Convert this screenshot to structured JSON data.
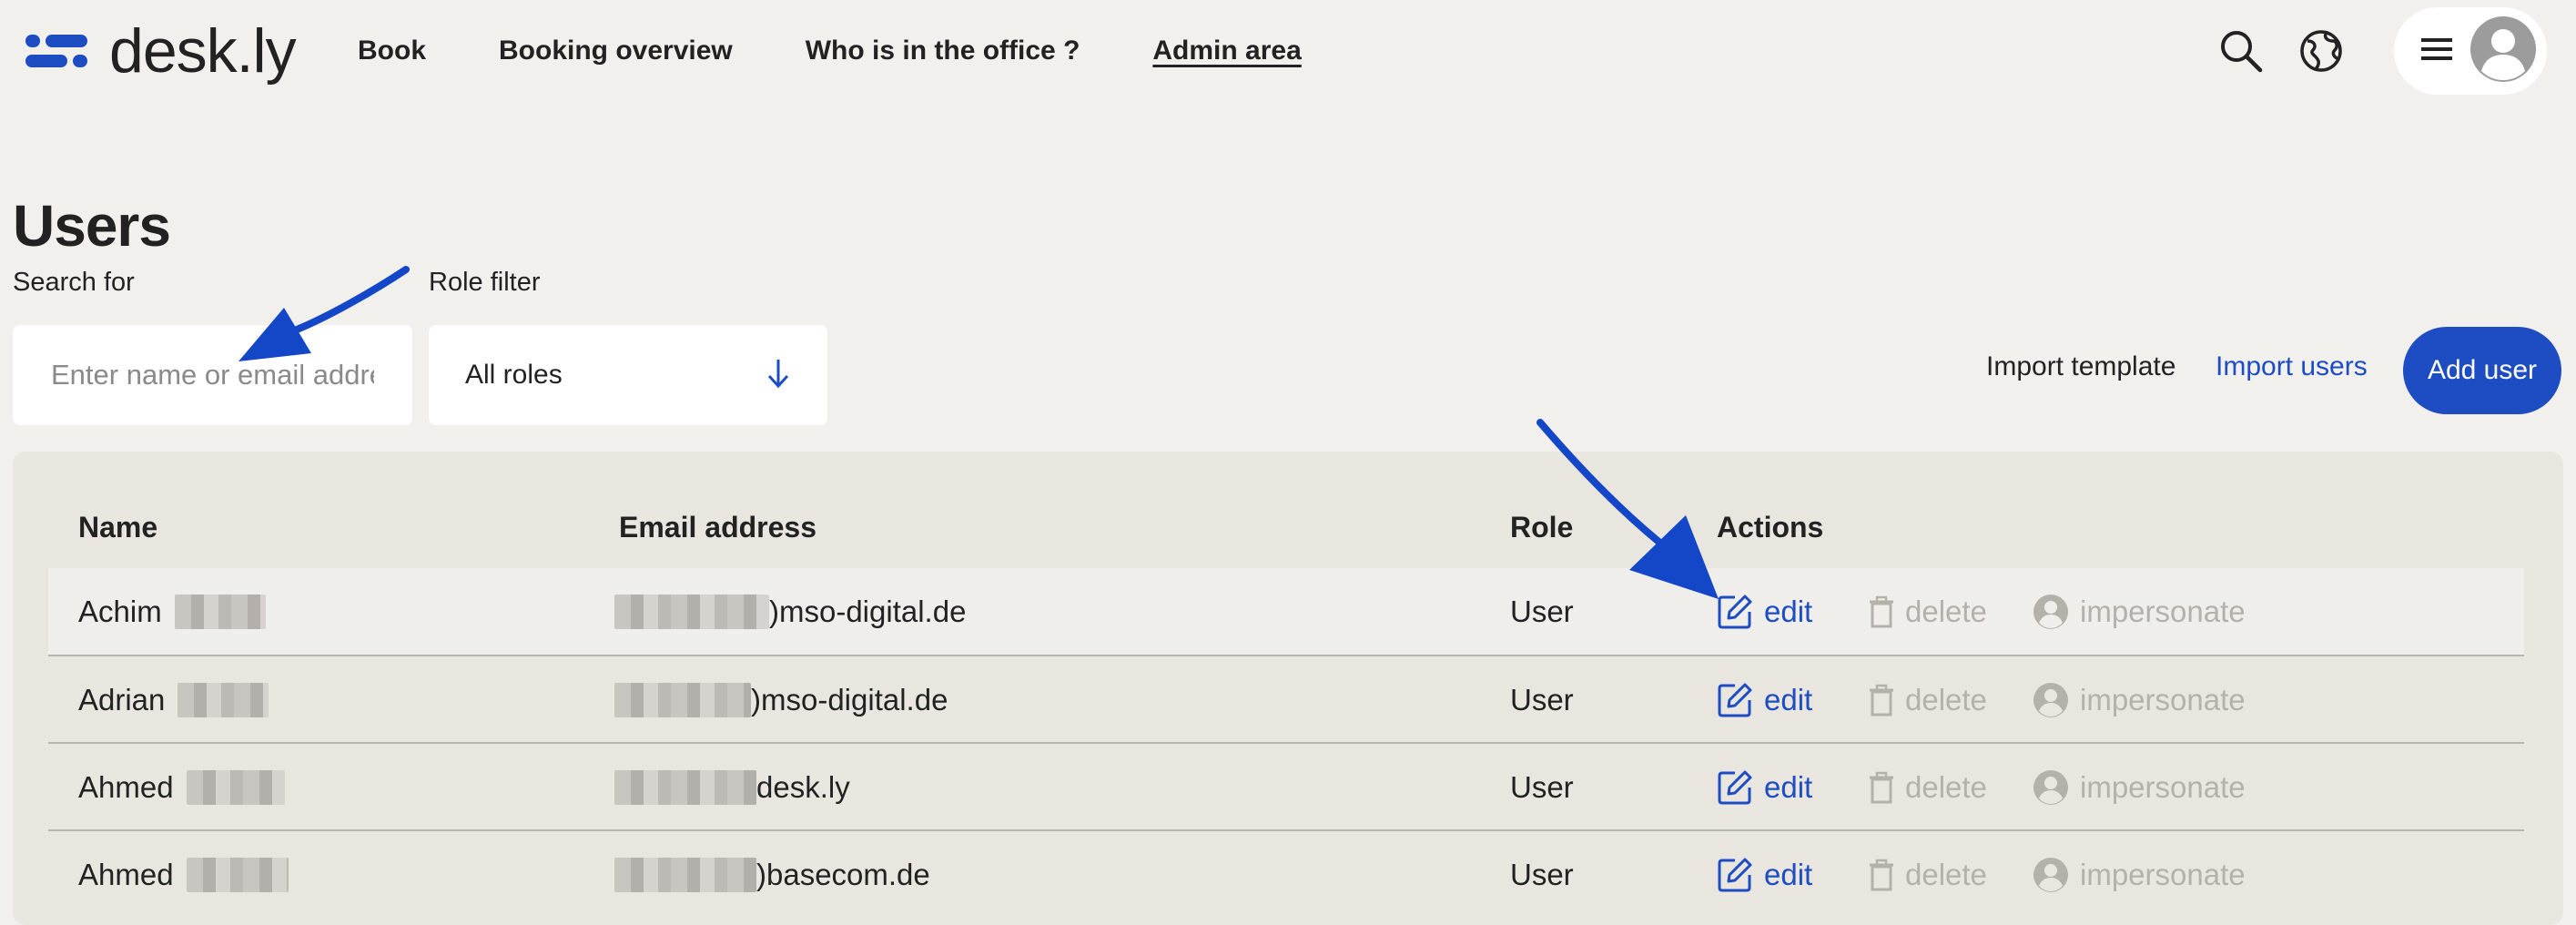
{
  "app": {
    "logo_text": "desk.ly",
    "brand_color": "#1d4cc3"
  },
  "nav": {
    "items": [
      {
        "label": "Book"
      },
      {
        "label": "Booking overview"
      },
      {
        "label": "Who is in the office ?"
      },
      {
        "label": "Admin area",
        "active": true
      }
    ],
    "icons": [
      "search-icon",
      "globe-icon",
      "menu-icon",
      "avatar-icon"
    ]
  },
  "page": {
    "title": "Users"
  },
  "filters": {
    "search_label": "Search for",
    "search_placeholder": "Enter name or email address",
    "search_value": "",
    "role_label": "Role filter",
    "role_value": "All roles"
  },
  "toolbar": {
    "import_template": "Import template",
    "import_users": "Import users",
    "add_user": "Add user"
  },
  "table": {
    "columns": {
      "name": "Name",
      "email": "Email address",
      "role": "Role",
      "actions": "Actions"
    },
    "action_labels": {
      "edit": "edit",
      "delete": "delete",
      "impersonate": "impersonate"
    },
    "rows": [
      {
        "first_name": "Achim",
        "email_domain": "mso-digital.de",
        "email_shown": ")mso-digital.de",
        "role": "User"
      },
      {
        "first_name": "Adrian",
        "email_domain": "mso-digital.de",
        "email_shown": ")mso-digital.de",
        "role": "User"
      },
      {
        "first_name": "Ahmed",
        "email_domain": "desk.ly",
        "email_shown": "desk.ly",
        "role": "User"
      },
      {
        "first_name": "Ahmed",
        "email_domain": "basecom.de",
        "email_shown": ")basecom.de",
        "role": "User"
      }
    ]
  },
  "colors": {
    "background": "#f2f0ec",
    "panel": "#e9e6e0",
    "accent": "#1d4cc3",
    "disabled_action": "#b4b1ab",
    "annotation_arrow": "#1446c8"
  }
}
